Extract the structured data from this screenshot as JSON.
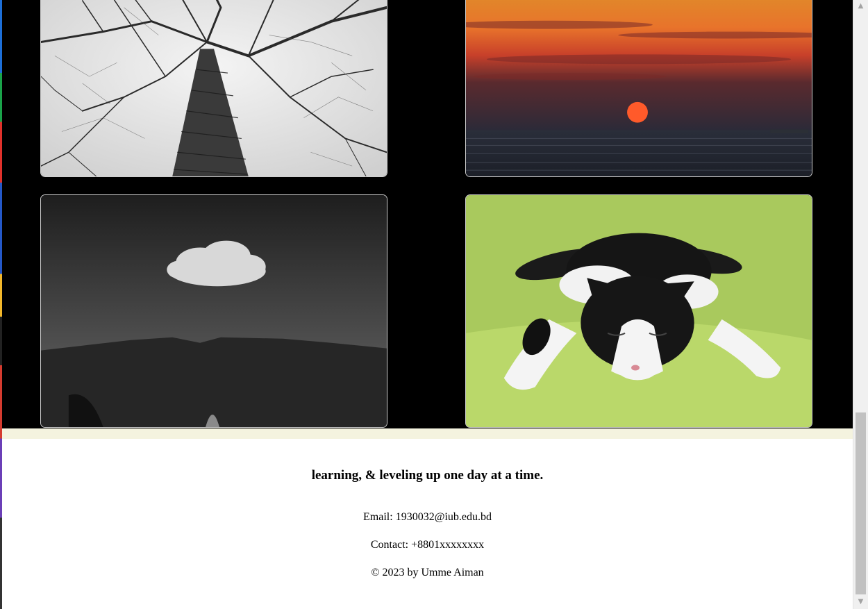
{
  "gallery": {
    "images": [
      {
        "subject": "bare tree viewed from below, black and white"
      },
      {
        "subject": "red sunset over the sea"
      },
      {
        "subject": "single cloud above dark rocky cliff"
      },
      {
        "subject": "black and white kitten sleeping on green blanket"
      }
    ]
  },
  "footer": {
    "tagline": "learning, & leveling up one day at a time.",
    "email": "Email: 1930032@iub.edu.bd",
    "contact": "Contact: +8801xxxxxxxx",
    "copyright": "© 2023 by Umme Aiman"
  },
  "scrollbar": {
    "up_icon": "arrow-up-icon",
    "down_icon": "arrow-down-icon"
  }
}
